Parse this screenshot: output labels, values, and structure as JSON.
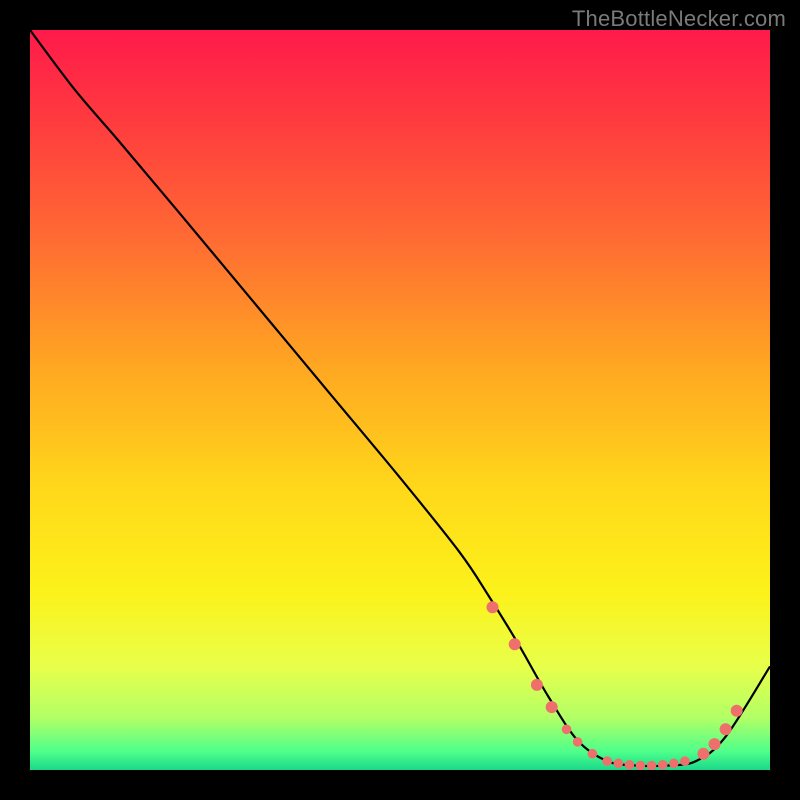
{
  "watermark": "TheBottleNecker.com",
  "chart_data": {
    "type": "line",
    "title": "",
    "xlabel": "",
    "ylabel": "",
    "xlim": [
      0,
      100
    ],
    "ylim": [
      0,
      100
    ],
    "background_gradient": {
      "stops": [
        {
          "offset": 0.0,
          "color": "#ff1a4b"
        },
        {
          "offset": 0.12,
          "color": "#ff3a3f"
        },
        {
          "offset": 0.28,
          "color": "#ff6a33"
        },
        {
          "offset": 0.45,
          "color": "#ffa522"
        },
        {
          "offset": 0.62,
          "color": "#ffd81a"
        },
        {
          "offset": 0.76,
          "color": "#fcf21a"
        },
        {
          "offset": 0.86,
          "color": "#e8ff4a"
        },
        {
          "offset": 0.93,
          "color": "#b1ff66"
        },
        {
          "offset": 0.975,
          "color": "#4eff8a"
        },
        {
          "offset": 1.0,
          "color": "#1bd98b"
        }
      ]
    },
    "series": [
      {
        "name": "bottleneck-curve",
        "color": "#000000",
        "x": [
          0,
          6,
          12,
          20,
          30,
          40,
          50,
          58,
          62,
          66,
          70,
          74,
          78,
          82,
          86,
          90,
          94,
          100
        ],
        "y": [
          100,
          92,
          85,
          75.5,
          63.5,
          51.5,
          39.5,
          29.5,
          23.5,
          17,
          10,
          4,
          1.2,
          0.6,
          0.6,
          1.2,
          4.5,
          14
        ]
      }
    ],
    "markers": {
      "color": "#ef6f6d",
      "radius_large": 6.0,
      "radius_small": 4.8,
      "points": [
        {
          "x": 62.5,
          "y": 22,
          "r": "large"
        },
        {
          "x": 65.5,
          "y": 17,
          "r": "large"
        },
        {
          "x": 68.5,
          "y": 11.5,
          "r": "large"
        },
        {
          "x": 70.5,
          "y": 8.5,
          "r": "large"
        },
        {
          "x": 72.5,
          "y": 5.5,
          "r": "small"
        },
        {
          "x": 74.0,
          "y": 3.8,
          "r": "small"
        },
        {
          "x": 76.0,
          "y": 2.2,
          "r": "small"
        },
        {
          "x": 78.0,
          "y": 1.2,
          "r": "small"
        },
        {
          "x": 79.5,
          "y": 0.9,
          "r": "small"
        },
        {
          "x": 81.0,
          "y": 0.7,
          "r": "small"
        },
        {
          "x": 82.5,
          "y": 0.6,
          "r": "small"
        },
        {
          "x": 84.0,
          "y": 0.6,
          "r": "small"
        },
        {
          "x": 85.5,
          "y": 0.7,
          "r": "small"
        },
        {
          "x": 87.0,
          "y": 0.9,
          "r": "small"
        },
        {
          "x": 88.5,
          "y": 1.2,
          "r": "small"
        },
        {
          "x": 91.0,
          "y": 2.2,
          "r": "large"
        },
        {
          "x": 92.5,
          "y": 3.5,
          "r": "large"
        },
        {
          "x": 94.0,
          "y": 5.5,
          "r": "large"
        },
        {
          "x": 95.5,
          "y": 8.0,
          "r": "large"
        }
      ]
    }
  }
}
